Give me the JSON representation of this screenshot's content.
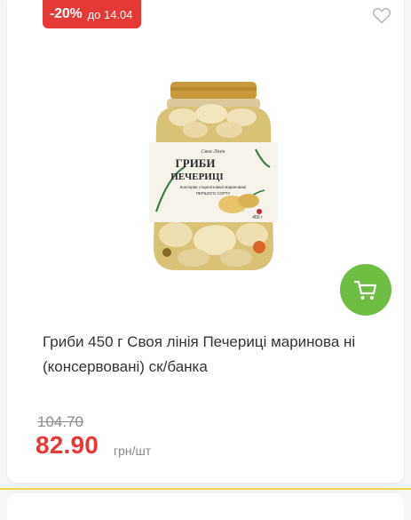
{
  "badge": {
    "discount": "-20%",
    "valid_until": "до 14.04",
    "color": "#e53935"
  },
  "icons": {
    "favorite": "heart-outline-icon",
    "cart": "cart-icon"
  },
  "product": {
    "title": "Гриби 450 г Своя лінія Печериці маринова ні (консервовані) ск/банка",
    "old_price": "104.70",
    "price": "82.90",
    "unit": "грн/шт",
    "label": {
      "brand": "Своя Лінія",
      "name_line1": "ГРИБИ",
      "name_line2": "ПЕЧЕРИЦІ",
      "desc1": "Консерви стерилізовані мариновані",
      "desc2": "ПЕРШОГО СОРТУ",
      "weight": "450 г"
    }
  },
  "colors": {
    "accent_green": "#6fbe44",
    "price_red": "#e53935",
    "divider_yellow": "#f0d74a"
  }
}
